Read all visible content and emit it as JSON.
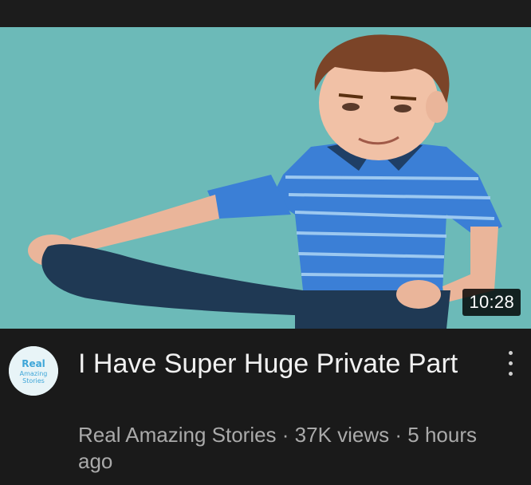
{
  "video": {
    "title": "I Have Super Huge Private Part",
    "duration": "10:28",
    "channel": "Real Amazing Stories",
    "views": "37K views",
    "age": "5 hours ago",
    "separator": " · "
  },
  "channel_avatar": {
    "line1": "Real",
    "line2": "Amazing",
    "line3": "Stories"
  },
  "icons": {
    "menu": "more-vert-icon"
  },
  "colors": {
    "background": "#1a1a1a",
    "thumbnail_bg": "#6cbab8",
    "title_text": "#f1f1f1",
    "meta_text": "#aaaaaa",
    "shirt": "#3b7fd6"
  }
}
